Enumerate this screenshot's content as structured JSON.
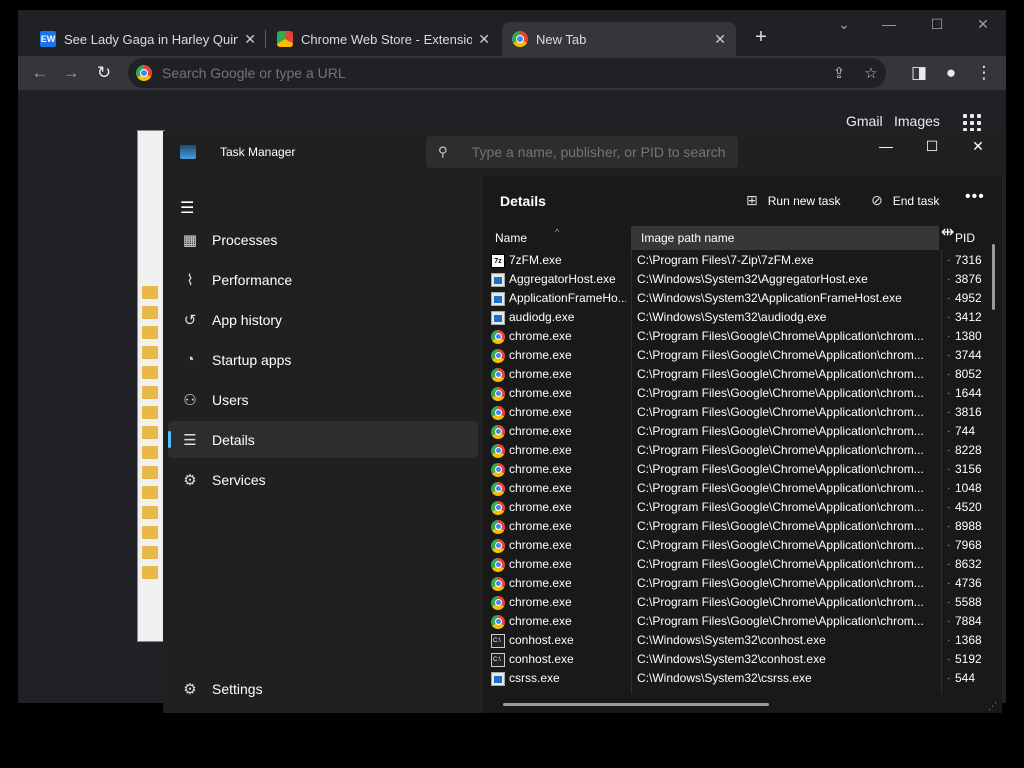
{
  "browser": {
    "tabs": [
      {
        "title": "See Lady Gaga in Harley Quinn r",
        "favicon": "EW",
        "close": "✕"
      },
      {
        "title": "Chrome Web Store - Extensions",
        "close": "✕"
      },
      {
        "title": "New Tab",
        "close": "✕"
      }
    ],
    "new_tab": "+",
    "omnibox_placeholder": "Search Google or type a URL",
    "ntp_links": {
      "gmail": "Gmail",
      "images": "Images"
    }
  },
  "task_manager": {
    "title": "Task Manager",
    "search_placeholder": "Type a name, publisher, or PID to search",
    "nav": [
      {
        "label": "Processes",
        "icon": "processes-icon"
      },
      {
        "label": "Performance",
        "icon": "performance-icon"
      },
      {
        "label": "App history",
        "icon": "history-icon"
      },
      {
        "label": "Startup apps",
        "icon": "startup-icon"
      },
      {
        "label": "Users",
        "icon": "users-icon"
      },
      {
        "label": "Details",
        "icon": "details-icon",
        "selected": true
      },
      {
        "label": "Services",
        "icon": "services-icon"
      }
    ],
    "settings_label": "Settings",
    "details": {
      "title": "Details",
      "run_new_task": "Run new task",
      "end_task": "End task",
      "columns": {
        "name": "Name",
        "path": "Image path name",
        "pid": "PID"
      },
      "rows": [
        {
          "name": "7zFM.exe",
          "icon": "7z",
          "path": "C:\\Program Files\\7-Zip\\7zFM.exe",
          "pid": "7316"
        },
        {
          "name": "AggregatorHost.exe",
          "icon": "win",
          "path": "C:\\Windows\\System32\\AggregatorHost.exe",
          "pid": "3876"
        },
        {
          "name": "ApplicationFrameHo...",
          "icon": "win",
          "path": "C:\\Windows\\System32\\ApplicationFrameHost.exe",
          "pid": "4952"
        },
        {
          "name": "audiodg.exe",
          "icon": "win",
          "path": "C:\\Windows\\System32\\audiodg.exe",
          "pid": "3412"
        },
        {
          "name": "chrome.exe",
          "icon": "chrome",
          "path": "C:\\Program Files\\Google\\Chrome\\Application\\chrom...",
          "pid": "1380"
        },
        {
          "name": "chrome.exe",
          "icon": "chrome",
          "path": "C:\\Program Files\\Google\\Chrome\\Application\\chrom...",
          "pid": "3744"
        },
        {
          "name": "chrome.exe",
          "icon": "chrome",
          "path": "C:\\Program Files\\Google\\Chrome\\Application\\chrom...",
          "pid": "8052"
        },
        {
          "name": "chrome.exe",
          "icon": "chrome",
          "path": "C:\\Program Files\\Google\\Chrome\\Application\\chrom...",
          "pid": "1644"
        },
        {
          "name": "chrome.exe",
          "icon": "chrome",
          "path": "C:\\Program Files\\Google\\Chrome\\Application\\chrom...",
          "pid": "3816"
        },
        {
          "name": "chrome.exe",
          "icon": "chrome",
          "path": "C:\\Program Files\\Google\\Chrome\\Application\\chrom...",
          "pid": "744"
        },
        {
          "name": "chrome.exe",
          "icon": "chrome",
          "path": "C:\\Program Files\\Google\\Chrome\\Application\\chrom...",
          "pid": "8228"
        },
        {
          "name": "chrome.exe",
          "icon": "chrome",
          "path": "C:\\Program Files\\Google\\Chrome\\Application\\chrom...",
          "pid": "3156"
        },
        {
          "name": "chrome.exe",
          "icon": "chrome",
          "path": "C:\\Program Files\\Google\\Chrome\\Application\\chrom...",
          "pid": "1048"
        },
        {
          "name": "chrome.exe",
          "icon": "chrome",
          "path": "C:\\Program Files\\Google\\Chrome\\Application\\chrom...",
          "pid": "4520"
        },
        {
          "name": "chrome.exe",
          "icon": "chrome",
          "path": "C:\\Program Files\\Google\\Chrome\\Application\\chrom...",
          "pid": "8988"
        },
        {
          "name": "chrome.exe",
          "icon": "chrome",
          "path": "C:\\Program Files\\Google\\Chrome\\Application\\chrom...",
          "pid": "7968"
        },
        {
          "name": "chrome.exe",
          "icon": "chrome",
          "path": "C:\\Program Files\\Google\\Chrome\\Application\\chrom...",
          "pid": "8632"
        },
        {
          "name": "chrome.exe",
          "icon": "chrome",
          "path": "C:\\Program Files\\Google\\Chrome\\Application\\chrom...",
          "pid": "4736"
        },
        {
          "name": "chrome.exe",
          "icon": "chrome",
          "path": "C:\\Program Files\\Google\\Chrome\\Application\\chrom...",
          "pid": "5588"
        },
        {
          "name": "chrome.exe",
          "icon": "chrome",
          "path": "C:\\Program Files\\Google\\Chrome\\Application\\chrom...",
          "pid": "7884"
        },
        {
          "name": "conhost.exe",
          "icon": "console",
          "path": "C:\\Windows\\System32\\conhost.exe",
          "pid": "1368"
        },
        {
          "name": "conhost.exe",
          "icon": "console",
          "path": "C:\\Windows\\System32\\conhost.exe",
          "pid": "5192"
        },
        {
          "name": "csrss.exe",
          "icon": "win",
          "path": "C:\\Windows\\System32\\csrss.exe",
          "pid": "544"
        }
      ]
    }
  },
  "colors": {
    "accent": "#4cc2ff",
    "tm_bg": "#202020",
    "chrome_bg": "#202124"
  }
}
